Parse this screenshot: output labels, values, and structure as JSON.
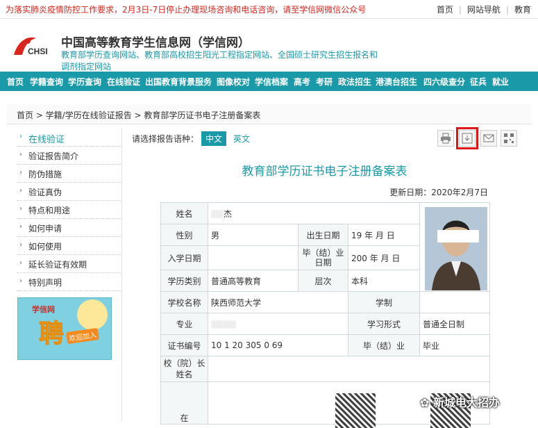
{
  "notice": "为落实肺炎疫情防控工作要求，2月3日-7日停止办理现场咨询和电话咨询，请至学信网微信公众号",
  "top_links": [
    "首页",
    "网站导航",
    "教育"
  ],
  "header": {
    "logo_text": "CHSI",
    "title": "中国高等教育学生信息网（学信网）",
    "subtitle": "教育部学历查询网站、教育部高校招生阳光工程指定网站、全国硕士研究生招生报名和调剂指定网站"
  },
  "nav": [
    "首页",
    "学籍查询",
    "学历查询",
    "在线验证",
    "出国教育背景服务",
    "图像校对",
    "学信档案",
    "高考",
    "考研",
    "政法招生",
    "港澳台招生",
    "四六级查分",
    "征兵",
    "就业"
  ],
  "breadcrumb": "首页 > 学籍/学历在线验证报告 > 教育部学历证书电子注册备案表",
  "sidebar": {
    "items": [
      "在线验证",
      "验证报告简介",
      "防伪措施",
      "验证真伪",
      "特点和用途",
      "如何申请",
      "如何使用",
      "延长验证有效期",
      "特别声明"
    ],
    "banner_logo": "学信网",
    "banner_big": "聘",
    "banner_small": "欢迎加入"
  },
  "lang": {
    "label": "请选择报告语种：",
    "options": [
      "中文",
      "英文"
    ]
  },
  "tools": [
    "print-icon",
    "download-icon",
    "mail-icon",
    "qrcode-icon"
  ],
  "doc": {
    "title": "教育部学历证书电子注册备案表",
    "update_date": "更新日期：2020年2月7日",
    "labels": {
      "name": "姓名",
      "gender": "性别",
      "birth": "出生日期",
      "enroll": "入学日期",
      "grad_date": "毕（结）业日期",
      "edu_type": "学历类别",
      "level": "层次",
      "school": "学校名称",
      "duration": "学制",
      "major": "专业",
      "study_form": "学习形式",
      "cert_no": "证书编号",
      "grad": "毕（结）业",
      "principal": "校（院）长姓名",
      "last": "在"
    },
    "values": {
      "name": "杰",
      "gender": "男",
      "birth": "19 年 月 日",
      "grad_date": "200 年 月 日",
      "edu_type": "普通高等教育",
      "level": "本科",
      "school": "陕西师范大学",
      "study_form": "普通全日制",
      "cert_no": "10 1 20 305 0 69",
      "grad": "毕业"
    }
  },
  "watermark": "新城电大招办"
}
